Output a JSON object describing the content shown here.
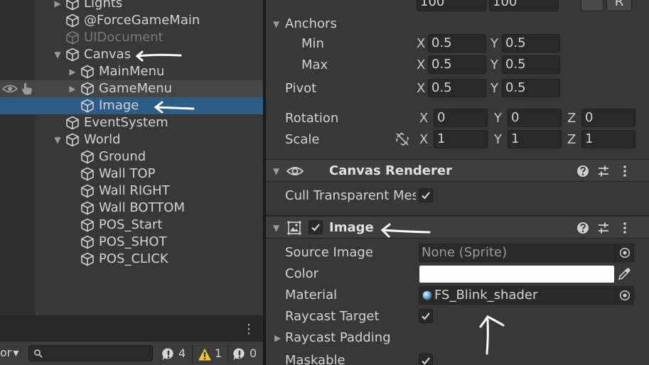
{
  "hierarchy": {
    "items": [
      {
        "label": "Lights",
        "depth": 1,
        "expand": "collapsed",
        "disabled": false
      },
      {
        "label": "@ForceGameMain",
        "depth": 1,
        "expand": "none",
        "disabled": false
      },
      {
        "label": "UIDocument",
        "depth": 1,
        "expand": "none",
        "disabled": true
      },
      {
        "label": "Canvas",
        "depth": 1,
        "expand": "expanded",
        "disabled": false
      },
      {
        "label": "MainMenu",
        "depth": 2,
        "expand": "collapsed",
        "disabled": false
      },
      {
        "label": "GameMenu",
        "depth": 2,
        "expand": "collapsed",
        "disabled": false
      },
      {
        "label": "Image",
        "depth": 2,
        "expand": "none",
        "disabled": false
      },
      {
        "label": "EventSystem",
        "depth": 1,
        "expand": "none",
        "disabled": false
      },
      {
        "label": "World",
        "depth": 1,
        "expand": "expanded",
        "disabled": false
      },
      {
        "label": "Ground",
        "depth": 2,
        "expand": "none",
        "disabled": false
      },
      {
        "label": "Wall TOP",
        "depth": 2,
        "expand": "none",
        "disabled": false
      },
      {
        "label": "Wall RIGHT",
        "depth": 2,
        "expand": "none",
        "disabled": false
      },
      {
        "label": "Wall BOTTOM",
        "depth": 2,
        "expand": "none",
        "disabled": false
      },
      {
        "label": "POS_Start",
        "depth": 2,
        "expand": "none",
        "disabled": false
      },
      {
        "label": "POS_SHOT",
        "depth": 2,
        "expand": "none",
        "disabled": false
      },
      {
        "label": "POS_CLICK",
        "depth": 2,
        "expand": "none",
        "disabled": false
      }
    ],
    "selected_label": "Image",
    "hovered_label": "GameMenu"
  },
  "console_toolbar": {
    "mode_label": "or",
    "mode_caret": "▾",
    "kebab": "⋮",
    "counts": {
      "info": "4",
      "warning": "1",
      "error": "0"
    }
  },
  "inspector": {
    "top_values": {
      "w": "100",
      "h": "100",
      "right_btn": "R"
    },
    "anchors": {
      "label": "Anchors",
      "min": {
        "label": "Min",
        "x_axis": "X",
        "x": "0.5",
        "y_axis": "Y",
        "y": "0.5"
      },
      "max": {
        "label": "Max",
        "x_axis": "X",
        "x": "0.5",
        "y_axis": "Y",
        "y": "0.5"
      }
    },
    "pivot": {
      "label": "Pivot",
      "x_axis": "X",
      "x": "0.5",
      "y_axis": "Y",
      "y": "0.5"
    },
    "rotation": {
      "label": "Rotation",
      "x_axis": "X",
      "x": "0",
      "y_axis": "Y",
      "y": "0",
      "z_axis": "Z",
      "z": "0"
    },
    "scale": {
      "label": "Scale",
      "x_axis": "X",
      "x": "1",
      "y_axis": "Y",
      "y": "1",
      "z_axis": "Z",
      "z": "1"
    },
    "canvas_renderer": {
      "title": "Canvas Renderer",
      "cull_label": "Cull Transparent Mesh",
      "cull_checked": true
    },
    "image": {
      "title": "Image",
      "enabled": true,
      "source_image": {
        "label": "Source Image",
        "value": "None (Sprite)"
      },
      "color": {
        "label": "Color",
        "value": "#ffffff"
      },
      "material": {
        "label": "Material",
        "value": "FS_Blink_shader"
      },
      "raycast_target": {
        "label": "Raycast Target",
        "checked": true
      },
      "raycast_padding": {
        "label": "Raycast Padding"
      },
      "maskable": {
        "label": "Maskable",
        "checked": true
      }
    }
  },
  "colors": {
    "selection": "#2c5d87",
    "panel": "#383838",
    "field": "#2a2a2a",
    "warning": "#f2c62c",
    "annotation": "#ffffff"
  }
}
